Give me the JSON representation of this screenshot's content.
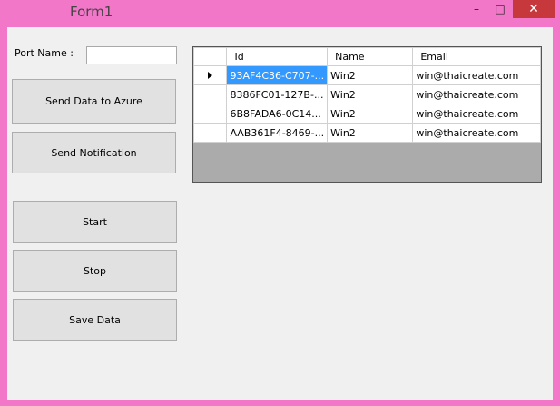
{
  "window": {
    "title": "Form1",
    "controls": {
      "minimize": "–",
      "maximize": "□",
      "close": "✕"
    }
  },
  "form": {
    "port_label": "Port Name :",
    "port_value": "",
    "buttons": {
      "send_azure": "Send Data to Azure",
      "send_notification": "Send Notification",
      "start": "Start",
      "stop": "Stop",
      "save": "Save Data"
    }
  },
  "grid": {
    "columns": [
      "Id",
      "Name",
      "Email"
    ],
    "rows": [
      {
        "id": "93AF4C36-C707-...",
        "name": "Win2",
        "email": "win@thaicreate.com"
      },
      {
        "id": "8386FC01-127B-...",
        "name": "Win2",
        "email": "win@thaicreate.com"
      },
      {
        "id": "6B8FADA6-0C14...",
        "name": "Win2",
        "email": "win@thaicreate.com"
      },
      {
        "id": "AAB361F4-8469-...",
        "name": "Win2",
        "email": "win@thaicreate.com"
      }
    ]
  },
  "colors": {
    "titlebar": "#f277c8",
    "close_button": "#c7383d",
    "selection": "#3399ff"
  }
}
